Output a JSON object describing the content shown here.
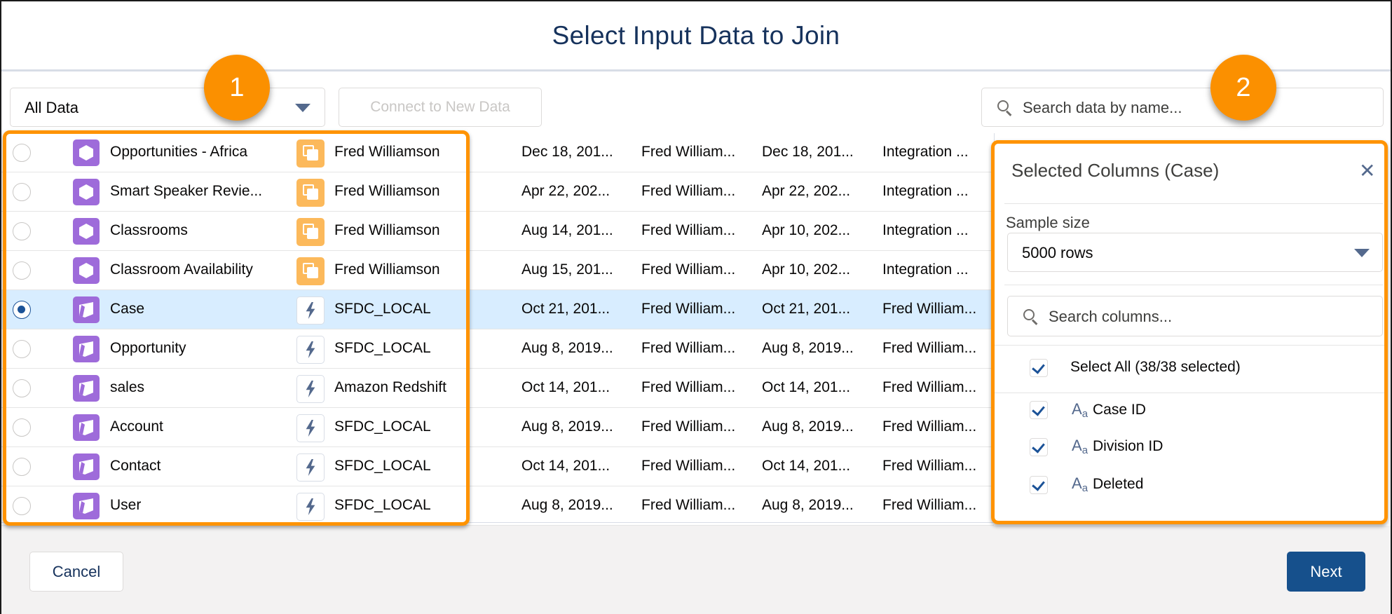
{
  "dialog": {
    "title": "Select Input Data to Join"
  },
  "toolbar": {
    "filter_value": "All Data",
    "connect_label": "Connect to New Data",
    "search_placeholder": "Search data by name..."
  },
  "rows": [
    {
      "name": "Opportunities - Africa",
      "name_icon": "dataset-hex-icon",
      "source": "Fred Williamson",
      "source_icon": "uploaded-file-icon",
      "c1": "Dec 18, 201...",
      "c2": "Fred William...",
      "c3": "Dec 18, 201...",
      "c4": "Integration ..."
    },
    {
      "name": "Smart Speaker Revie...",
      "name_icon": "dataset-hex-icon",
      "source": "Fred Williamson",
      "source_icon": "uploaded-file-icon",
      "c1": "Apr 22, 202...",
      "c2": "Fred William...",
      "c3": "Apr 22, 202...",
      "c4": "Integration ..."
    },
    {
      "name": "Classrooms",
      "name_icon": "dataset-hex-icon",
      "source": "Fred Williamson",
      "source_icon": "uploaded-file-icon",
      "c1": "Aug 14, 201...",
      "c2": "Fred William...",
      "c3": "Apr 10, 202...",
      "c4": "Integration ..."
    },
    {
      "name": "Classroom Availability",
      "name_icon": "dataset-hex-icon",
      "source": "Fred Williamson",
      "source_icon": "uploaded-file-icon",
      "c1": "Aug 15, 201...",
      "c2": "Fred William...",
      "c3": "Apr 10, 202...",
      "c4": "Integration ..."
    },
    {
      "name": "Case",
      "name_icon": "connected-object-icon",
      "source": "SFDC_LOCAL",
      "source_icon": "bolt-icon",
      "c1": "Oct 21, 201...",
      "c2": "Fred William...",
      "c3": "Oct 21, 201...",
      "c4": "Fred William...",
      "selected": true
    },
    {
      "name": "Opportunity",
      "name_icon": "connected-object-icon",
      "source": "SFDC_LOCAL",
      "source_icon": "bolt-icon",
      "c1": "Aug 8, 2019...",
      "c2": "Fred William...",
      "c3": "Aug 8, 2019...",
      "c4": "Fred William..."
    },
    {
      "name": "sales",
      "name_icon": "connected-object-icon",
      "source": "Amazon Redshift",
      "source_icon": "bolt-icon",
      "c1": "Oct 14, 201...",
      "c2": "Fred William...",
      "c3": "Oct 14, 201...",
      "c4": "Fred William..."
    },
    {
      "name": "Account",
      "name_icon": "connected-object-icon",
      "source": "SFDC_LOCAL",
      "source_icon": "bolt-icon",
      "c1": "Aug 8, 2019...",
      "c2": "Fred William...",
      "c3": "Aug 8, 2019...",
      "c4": "Fred William..."
    },
    {
      "name": "Contact",
      "name_icon": "connected-object-icon",
      "source": "SFDC_LOCAL",
      "source_icon": "bolt-icon",
      "c1": "Oct 14, 201...",
      "c2": "Fred William...",
      "c3": "Oct 14, 201...",
      "c4": "Fred William..."
    },
    {
      "name": "User",
      "name_icon": "connected-object-icon",
      "source": "SFDC_LOCAL",
      "source_icon": "bolt-icon",
      "c1": "Aug 8, 2019...",
      "c2": "Fred William...",
      "c3": "Aug 8, 2019...",
      "c4": "Fred William..."
    }
  ],
  "panel": {
    "title": "Selected Columns (Case)",
    "close_icon": "close-icon",
    "sample_size_label": "Sample size",
    "sample_size_value": "5000 rows",
    "search_placeholder": "Search columns...",
    "select_all_label": "Select All (38/38 selected)",
    "type_icon_text": {
      "big": "A",
      "small": "a"
    },
    "columns": [
      {
        "label": "Case ID",
        "checked": true
      },
      {
        "label": "Division ID",
        "checked": true
      },
      {
        "label": "Deleted",
        "checked": true
      }
    ]
  },
  "footer": {
    "cancel_label": "Cancel",
    "next_label": "Next"
  },
  "callouts": {
    "one": "1",
    "two": "2"
  },
  "colors": {
    "highlight": "#ff9300",
    "callout": "#fb9000",
    "selected_row": "#d8edff",
    "primary_button": "#16508c",
    "dataset_icon": "#9e6bda",
    "file_icon": "#fcb95b",
    "title": "#16325c"
  }
}
